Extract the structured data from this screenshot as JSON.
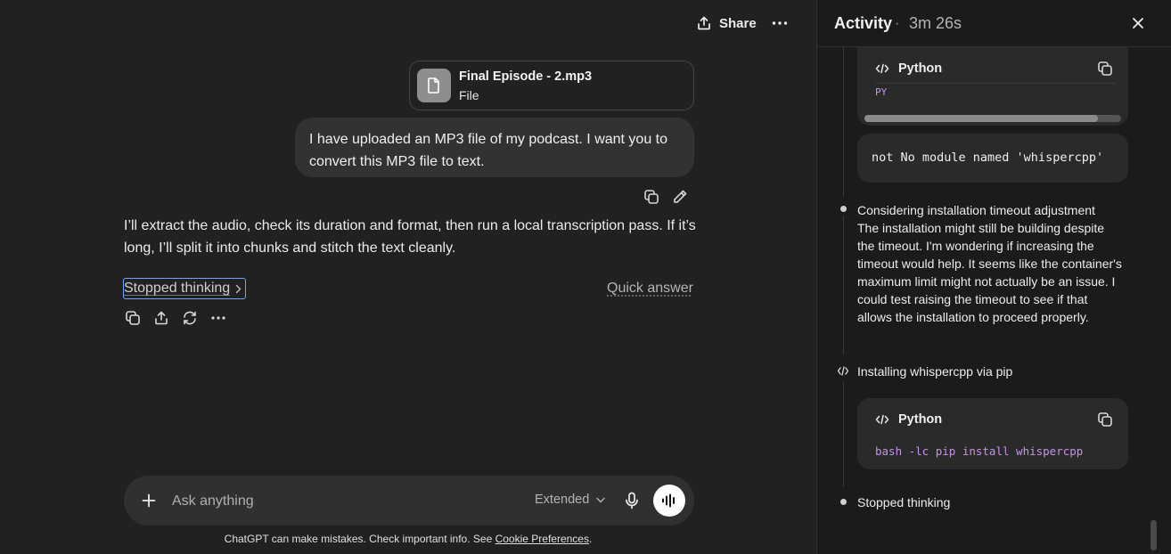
{
  "header": {
    "share_label": "Share",
    "share_icon": "share-icon",
    "more_icon": "more-horizontal-icon"
  },
  "attachment": {
    "name": "Final Episode - 2.mp3",
    "type": "File",
    "icon": "document-icon"
  },
  "user_message": {
    "text": "I have uploaded an MP3 file of my podcast. I want you to convert this MP3 file to text.",
    "actions": [
      "copy-icon",
      "edit-icon"
    ]
  },
  "assistant_message": {
    "text": "I’ll extract the audio, check its duration and format, then run a local transcription pass. If it’s long, I’ll split it into chunks and stitch the text cleanly.",
    "stopped_label": "Stopped thinking",
    "quick_answer_label": "Quick answer",
    "actions": [
      "copy-icon",
      "share-icon",
      "regenerate-icon",
      "more-horizontal-icon"
    ]
  },
  "composer": {
    "placeholder": "Ask anything",
    "mode": "Extended"
  },
  "disclaimer": {
    "text": "ChatGPT can make mistakes. Check important info. See ",
    "link": "Cookie Preferences",
    "suffix": "."
  },
  "activity": {
    "title": "Activity",
    "separator": "·",
    "duration": "3m 26s",
    "code_block_1": {
      "language": "Python",
      "code": "PY"
    },
    "output": "not No module named 'whispercpp'",
    "thought": {
      "title": "Considering installation timeout adjustment",
      "body": "The installation might still be building despite the timeout. I'm wondering if increasing the timeout would help. It seems like the container's maximum limit might not actually be an issue. I could test raising the timeout to see if that allows the installation to proceed properly."
    },
    "install_step": "Installing whispercpp via pip",
    "code_block_2": {
      "language": "Python",
      "code": "bash -lc pip install whispercpp"
    },
    "final_step": "Stopped thinking"
  },
  "colors": {
    "background": "#212121",
    "panel_background": "#1b1b1b",
    "bubble": "#323232",
    "code_keyword": "#c792ea",
    "focus_outline": "#6aa6ff"
  }
}
